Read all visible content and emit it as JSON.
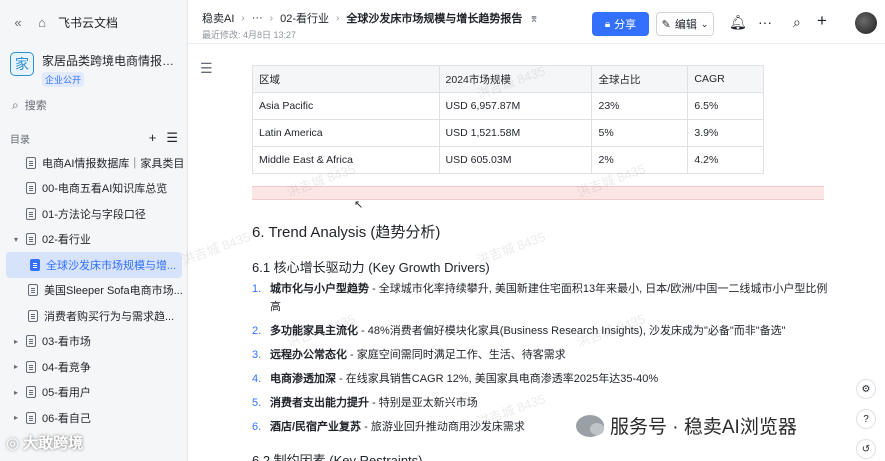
{
  "sidebar": {
    "app_name": "飞书云文档",
    "kb_title": "家居品类跨境电商情报系统...",
    "kb_logo_char": "家",
    "kb_badge": "企业公开",
    "search_placeholder": "搜索",
    "dir_label": "目录",
    "items": [
      {
        "label": "电商AI情报数据库｜家具类目",
        "indent": 0,
        "caret": "",
        "active": false
      },
      {
        "label": "00-电商五看AI知识库总览",
        "indent": 0,
        "caret": "",
        "active": false
      },
      {
        "label": "01-方法论与字段口径",
        "indent": 0,
        "caret": "",
        "active": false
      },
      {
        "label": "02-看行业",
        "indent": 0,
        "caret": "▾",
        "active": false
      },
      {
        "label": "全球沙发床市场规模与增...",
        "indent": 1,
        "caret": "",
        "active": true
      },
      {
        "label": "美国Sleeper Sofa电商市场...",
        "indent": 1,
        "caret": "",
        "active": false
      },
      {
        "label": "消费者购买行为与需求趋...",
        "indent": 1,
        "caret": "",
        "active": false
      },
      {
        "label": "03-看市场",
        "indent": 0,
        "caret": "▸",
        "active": false
      },
      {
        "label": "04-看竞争",
        "indent": 0,
        "caret": "▸",
        "active": false
      },
      {
        "label": "05-看用户",
        "indent": 0,
        "caret": "▸",
        "active": false
      },
      {
        "label": "06-看自己",
        "indent": 0,
        "caret": "▸",
        "active": false
      }
    ],
    "watermark": "大敢跨境"
  },
  "header": {
    "crumb_root": "稳卖AI",
    "crumb_more": "···",
    "crumb_parent": "02-看行业",
    "crumb_current": "全球沙发床市场规模与增长趋势报告",
    "last_edited": "最近修改: 4月8日 13:27",
    "share_label": "分享",
    "edit_label": "编辑"
  },
  "table": {
    "headers": [
      "区域",
      "2024市场规模",
      "全球占比",
      "CAGR"
    ],
    "rows": [
      [
        "Asia Pacific",
        "USD 6,957.87M",
        "23%",
        "6.5%"
      ],
      [
        "Latin America",
        "USD 1,521.58M",
        "5%",
        "3.9%"
      ],
      [
        "Middle East & Africa",
        "USD 605.03M",
        "2%",
        "4.2%"
      ]
    ]
  },
  "content": {
    "section_title": "6. Trend Analysis (趋势分析)",
    "subsection_title": "6.1 核心增长驱动力 (Key Growth Drivers)",
    "drivers": [
      {
        "num": "1.",
        "bold": "城市化与小户型趋势",
        "text": " - 全球城市化率持续攀升, 美国新建住宅面积13年来最小, 日本/欧洲/中国一二线城市小户型比例高"
      },
      {
        "num": "2.",
        "bold": "多功能家具主流化",
        "text": " - 48%消费者偏好模块化家具(Business Research Insights), 沙发床成为\"必备\"而非\"备选\""
      },
      {
        "num": "3.",
        "bold": "远程办公常态化",
        "text": " - 家庭空间需同时满足工作、生活、待客需求"
      },
      {
        "num": "4.",
        "bold": "电商渗透加深",
        "text": " - 在线家具销售CAGR 12%, 美国家具电商渗透率2025年达35-40%"
      },
      {
        "num": "5.",
        "bold": "消费者支出能力提升",
        "text": " - 特别是亚太新兴市场"
      },
      {
        "num": "6.",
        "bold": "酒店/民宿产业复苏",
        "text": " - 旅游业回升推动商用沙发床需求"
      }
    ],
    "next_subsection": "6.2 制约因素 (Key Restraints)"
  },
  "watermarks": {
    "repeat_text": "洪吉城 8435",
    "wechat": "服务号 · 稳卖AI浏览器"
  }
}
